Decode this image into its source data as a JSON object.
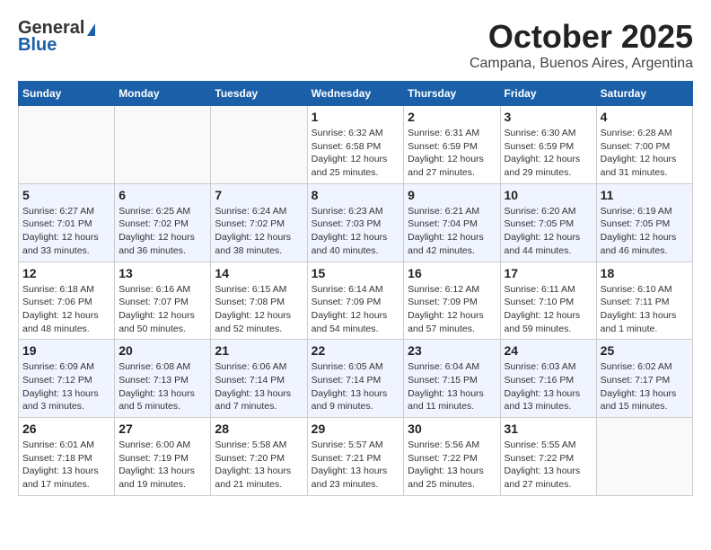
{
  "header": {
    "logo_general": "General",
    "logo_blue": "Blue",
    "month": "October 2025",
    "location": "Campana, Buenos Aires, Argentina"
  },
  "days_of_week": [
    "Sunday",
    "Monday",
    "Tuesday",
    "Wednesday",
    "Thursday",
    "Friday",
    "Saturday"
  ],
  "weeks": [
    [
      {
        "day": "",
        "info": ""
      },
      {
        "day": "",
        "info": ""
      },
      {
        "day": "",
        "info": ""
      },
      {
        "day": "1",
        "info": "Sunrise: 6:32 AM\nSunset: 6:58 PM\nDaylight: 12 hours and 25 minutes."
      },
      {
        "day": "2",
        "info": "Sunrise: 6:31 AM\nSunset: 6:59 PM\nDaylight: 12 hours and 27 minutes."
      },
      {
        "day": "3",
        "info": "Sunrise: 6:30 AM\nSunset: 6:59 PM\nDaylight: 12 hours and 29 minutes."
      },
      {
        "day": "4",
        "info": "Sunrise: 6:28 AM\nSunset: 7:00 PM\nDaylight: 12 hours and 31 minutes."
      }
    ],
    [
      {
        "day": "5",
        "info": "Sunrise: 6:27 AM\nSunset: 7:01 PM\nDaylight: 12 hours and 33 minutes."
      },
      {
        "day": "6",
        "info": "Sunrise: 6:25 AM\nSunset: 7:02 PM\nDaylight: 12 hours and 36 minutes."
      },
      {
        "day": "7",
        "info": "Sunrise: 6:24 AM\nSunset: 7:02 PM\nDaylight: 12 hours and 38 minutes."
      },
      {
        "day": "8",
        "info": "Sunrise: 6:23 AM\nSunset: 7:03 PM\nDaylight: 12 hours and 40 minutes."
      },
      {
        "day": "9",
        "info": "Sunrise: 6:21 AM\nSunset: 7:04 PM\nDaylight: 12 hours and 42 minutes."
      },
      {
        "day": "10",
        "info": "Sunrise: 6:20 AM\nSunset: 7:05 PM\nDaylight: 12 hours and 44 minutes."
      },
      {
        "day": "11",
        "info": "Sunrise: 6:19 AM\nSunset: 7:05 PM\nDaylight: 12 hours and 46 minutes."
      }
    ],
    [
      {
        "day": "12",
        "info": "Sunrise: 6:18 AM\nSunset: 7:06 PM\nDaylight: 12 hours and 48 minutes."
      },
      {
        "day": "13",
        "info": "Sunrise: 6:16 AM\nSunset: 7:07 PM\nDaylight: 12 hours and 50 minutes."
      },
      {
        "day": "14",
        "info": "Sunrise: 6:15 AM\nSunset: 7:08 PM\nDaylight: 12 hours and 52 minutes."
      },
      {
        "day": "15",
        "info": "Sunrise: 6:14 AM\nSunset: 7:09 PM\nDaylight: 12 hours and 54 minutes."
      },
      {
        "day": "16",
        "info": "Sunrise: 6:12 AM\nSunset: 7:09 PM\nDaylight: 12 hours and 57 minutes."
      },
      {
        "day": "17",
        "info": "Sunrise: 6:11 AM\nSunset: 7:10 PM\nDaylight: 12 hours and 59 minutes."
      },
      {
        "day": "18",
        "info": "Sunrise: 6:10 AM\nSunset: 7:11 PM\nDaylight: 13 hours and 1 minute."
      }
    ],
    [
      {
        "day": "19",
        "info": "Sunrise: 6:09 AM\nSunset: 7:12 PM\nDaylight: 13 hours and 3 minutes."
      },
      {
        "day": "20",
        "info": "Sunrise: 6:08 AM\nSunset: 7:13 PM\nDaylight: 13 hours and 5 minutes."
      },
      {
        "day": "21",
        "info": "Sunrise: 6:06 AM\nSunset: 7:14 PM\nDaylight: 13 hours and 7 minutes."
      },
      {
        "day": "22",
        "info": "Sunrise: 6:05 AM\nSunset: 7:14 PM\nDaylight: 13 hours and 9 minutes."
      },
      {
        "day": "23",
        "info": "Sunrise: 6:04 AM\nSunset: 7:15 PM\nDaylight: 13 hours and 11 minutes."
      },
      {
        "day": "24",
        "info": "Sunrise: 6:03 AM\nSunset: 7:16 PM\nDaylight: 13 hours and 13 minutes."
      },
      {
        "day": "25",
        "info": "Sunrise: 6:02 AM\nSunset: 7:17 PM\nDaylight: 13 hours and 15 minutes."
      }
    ],
    [
      {
        "day": "26",
        "info": "Sunrise: 6:01 AM\nSunset: 7:18 PM\nDaylight: 13 hours and 17 minutes."
      },
      {
        "day": "27",
        "info": "Sunrise: 6:00 AM\nSunset: 7:19 PM\nDaylight: 13 hours and 19 minutes."
      },
      {
        "day": "28",
        "info": "Sunrise: 5:58 AM\nSunset: 7:20 PM\nDaylight: 13 hours and 21 minutes."
      },
      {
        "day": "29",
        "info": "Sunrise: 5:57 AM\nSunset: 7:21 PM\nDaylight: 13 hours and 23 minutes."
      },
      {
        "day": "30",
        "info": "Sunrise: 5:56 AM\nSunset: 7:22 PM\nDaylight: 13 hours and 25 minutes."
      },
      {
        "day": "31",
        "info": "Sunrise: 5:55 AM\nSunset: 7:22 PM\nDaylight: 13 hours and 27 minutes."
      },
      {
        "day": "",
        "info": ""
      }
    ]
  ]
}
